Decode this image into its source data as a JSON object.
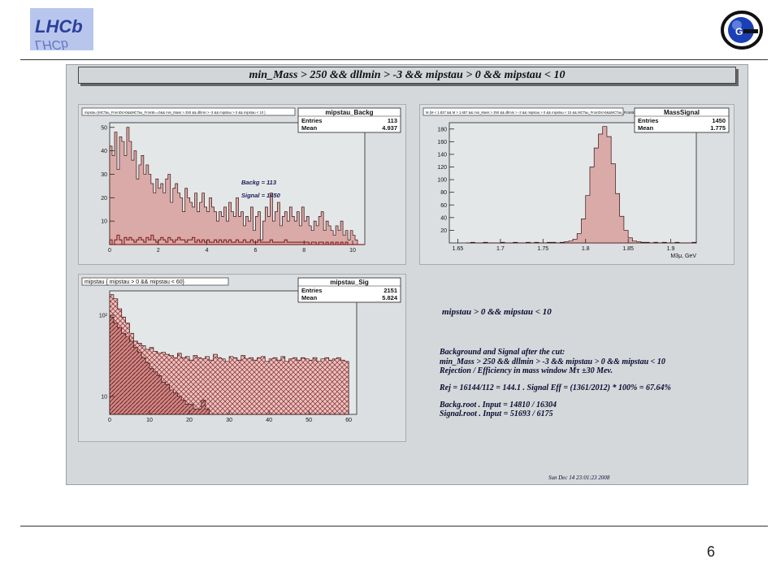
{
  "header": {
    "left_logo_text": "LHCb",
    "right_logo_text": "G"
  },
  "slide": {
    "page_number": "6"
  },
  "canvas": {
    "title": "min_Mass > 250 && dllmin > -3 && mipstau > 0 && mipstau < 10",
    "timestamp": "Sun Dec 14 23:01:23 2008"
  },
  "notes": {
    "line1": "mipstau > 0 && mipstau < 10",
    "line2": "Background and Signal after the cut:",
    "line3": " min_Mass > 250 && dllmin > -3 && mipstau > 0 && mipstau < 10",
    "line4": "Rejection / Efficiency in mass window  Mτ ±30 Mev.",
    "line5": "Rej = 16144/112 =  144.1 .     Signal Eff = (1361/2012) * 100% = 67.64%",
    "line6": "Backg.root . Input = 14810 / 16304",
    "line7": "Signal.root . Input = 51693 / 6175"
  },
  "colors": {
    "fill": "#d9aaa8",
    "stroke": "#8a2a2a",
    "hatch": "#9c3a3a",
    "pad": "#dcdfe1"
  },
  "chart_data": [
    {
      "type": "bar",
      "pad_title": "mipstau {MCTau_FromDs>0&&MCTau_FromB==0&& min_Mass > 250 && dllmin > -3 && mipstau > 0 && mipstau < 10 }",
      "stats_name": "mipstau_Backg",
      "entries_label": "Entries",
      "entries": "113",
      "mean_label": "Mean",
      "mean": "4.937",
      "annotation1": "Backg  = 113",
      "annotation2": "Signal = 1450",
      "xlim": [
        0,
        10.5
      ],
      "ylim": [
        0,
        52
      ],
      "xticks": [
        "0",
        "2",
        "4",
        "6",
        "8",
        "10"
      ],
      "yticks": [
        "10",
        "20",
        "30",
        "40",
        "50"
      ],
      "x_start": 0,
      "bin_width": 0.1,
      "series": [
        {
          "values": [
            42,
            38,
            48,
            32,
            46,
            44,
            38,
            50,
            44,
            36,
            40,
            28,
            34,
            38,
            30,
            34,
            30,
            26,
            22,
            28,
            24,
            26,
            22,
            28,
            30,
            18,
            24,
            26,
            22,
            20,
            14,
            24,
            20,
            18,
            16,
            22,
            14,
            18,
            22,
            16,
            14,
            20,
            16,
            14,
            10,
            14,
            12,
            16,
            10,
            18,
            14,
            12,
            20,
            12,
            14,
            8,
            12,
            10,
            16,
            6,
            12,
            14,
            2,
            10,
            16,
            12,
            22,
            10,
            14,
            18,
            8,
            12,
            14,
            10,
            16,
            12,
            10,
            14,
            8,
            16,
            10,
            12,
            8,
            6,
            10,
            8,
            12,
            14,
            6,
            10,
            8,
            6,
            4,
            8,
            6,
            10,
            4,
            6,
            2,
            6,
            4,
            2,
            0,
            0,
            0
          ]
        },
        {
          "values": [
            2,
            0,
            2,
            4,
            2,
            0,
            3,
            2,
            3,
            2,
            1,
            2,
            3,
            2,
            1,
            3,
            2,
            4,
            2,
            1,
            2,
            3,
            2,
            1,
            3,
            2,
            1,
            2,
            3,
            2,
            2,
            1,
            2,
            2,
            3,
            1,
            2,
            1,
            2,
            1,
            2,
            1,
            1,
            2,
            1,
            2,
            1,
            2,
            1,
            2,
            1,
            1,
            2,
            1,
            1,
            2,
            1,
            1,
            2,
            1,
            1,
            2,
            1,
            1,
            1,
            1,
            2,
            1,
            1,
            1,
            1,
            1,
            2,
            1,
            1,
            1,
            1,
            1,
            1,
            1,
            1,
            1,
            0,
            1,
            1,
            0,
            1,
            1,
            0,
            1,
            0,
            1,
            0,
            1,
            0,
            1,
            0,
            1,
            0,
            0,
            0,
            0,
            0,
            0,
            0
          ]
        }
      ]
    },
    {
      "type": "bar",
      "pad_title": "M {M < 1.837 && M > 1.657 && min_Mass > 250 && dllmin > -3 && mipstau > 0 && mipstau < 10 && MCTau_FromDs>0&&MCTau_FromB==0}",
      "stats_name": "MassSignal",
      "entries_label": "Entries",
      "entries": "1450",
      "mean_label": "Mean",
      "mean": "1.775",
      "xlabel": "M3μ, GeV",
      "xlim": [
        1.64,
        1.93
      ],
      "ylim": [
        0,
        190
      ],
      "xticks": [
        "1.65",
        "1.7",
        "1.75",
        "1.8",
        "1.85",
        "1.9"
      ],
      "yticks": [
        "20",
        "40",
        "60",
        "80",
        "100",
        "120",
        "140",
        "160",
        "180"
      ],
      "x_start": 1.66,
      "bin_width": 0.005,
      "series": [
        {
          "values": [
            0,
            1,
            0,
            0,
            1,
            0,
            0,
            0,
            1,
            0,
            0,
            1,
            0,
            0,
            1,
            0,
            1,
            0,
            0,
            1,
            1,
            0,
            1,
            2,
            3,
            6,
            15,
            38,
            75,
            120,
            150,
            172,
            184,
            168,
            125,
            78,
            42,
            20,
            8,
            3,
            2,
            1,
            1,
            0,
            1,
            0,
            1,
            0,
            0,
            1,
            0,
            0,
            0,
            1,
            0,
            0
          ]
        }
      ]
    },
    {
      "type": "bar",
      "pad_title": "mipstau { mipstau > 0 && mipstau < 60}",
      "stats_name": "mipstau_Sig",
      "entries_label": "Entries",
      "entries": "2151",
      "mean_label": "Mean",
      "mean": "5.824",
      "y_scale": "log",
      "xlim": [
        0,
        62
      ],
      "ylim": [
        6,
        200
      ],
      "xticks": [
        "0",
        "10",
        "20",
        "30",
        "40",
        "50",
        "60"
      ],
      "yticks": [
        "10",
        "10²"
      ],
      "x_start": 0,
      "bin_width": 1,
      "series": [
        {
          "values": [
            180,
            160,
            120,
            95,
            80,
            60,
            48,
            45,
            42,
            38,
            40,
            36,
            34,
            35,
            33,
            32,
            30,
            34,
            30,
            31,
            28,
            32,
            30,
            29,
            31,
            28,
            33,
            30,
            29,
            27,
            31,
            30,
            28,
            32,
            29,
            30,
            28,
            30,
            31,
            27,
            29,
            30,
            28,
            31,
            27,
            29,
            30,
            28,
            30,
            29,
            28,
            30,
            27,
            29,
            30,
            28,
            29,
            30,
            28,
            27
          ]
        },
        {
          "values": [
            95,
            80,
            70,
            60,
            55,
            48,
            40,
            35,
            30,
            26,
            22,
            20,
            18,
            15,
            14,
            12,
            11,
            10,
            9,
            8,
            8,
            7,
            7,
            9,
            7,
            6,
            0,
            0,
            0,
            0,
            0,
            0,
            0,
            0,
            0,
            0,
            0,
            0,
            0,
            0,
            0,
            0,
            0,
            0,
            0,
            0,
            0,
            0,
            0,
            0,
            0,
            0,
            0,
            0,
            0,
            0,
            0,
            0,
            0,
            0
          ]
        }
      ]
    }
  ]
}
